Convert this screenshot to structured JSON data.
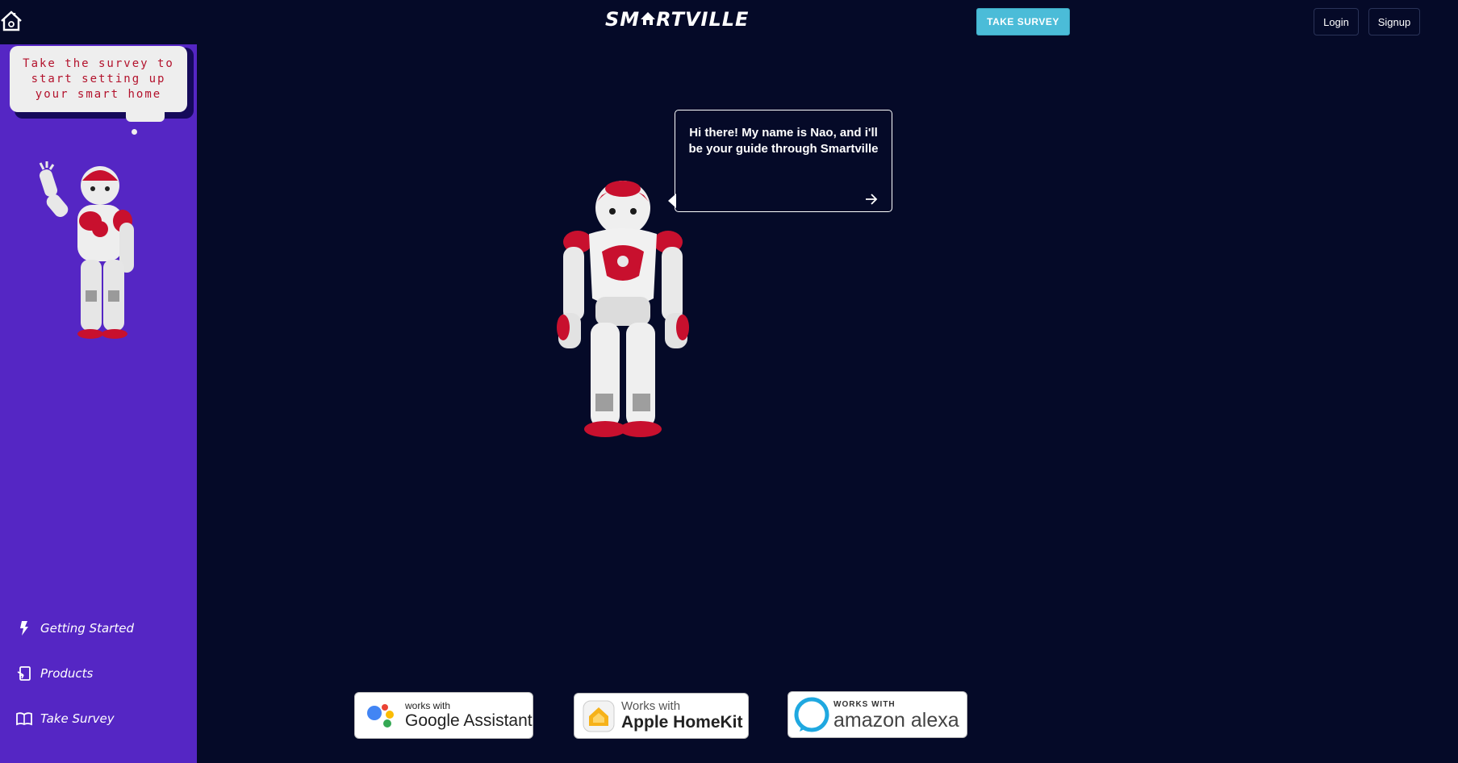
{
  "header": {
    "brand_prefix": "SM",
    "brand_suffix": "RTVILLE",
    "take_survey_label": "TAKE SURVEY",
    "login_label": "Login",
    "signup_label": "Signup"
  },
  "sidebar": {
    "thought_text": "Take the survey to start setting up your smart home",
    "items": [
      {
        "label": "Getting Started",
        "icon": "lightning-icon"
      },
      {
        "label": "Products",
        "icon": "device-icon"
      },
      {
        "label": "Take Survey",
        "icon": "book-icon"
      }
    ]
  },
  "main": {
    "speech_text": "Hi there! My name is Nao, and i'll be your guide through Smartville"
  },
  "badges": {
    "google": {
      "small": "works with",
      "big": "Google Assistant"
    },
    "homekit": {
      "small": "Works with",
      "big": "Apple HomeKit"
    },
    "alexa": {
      "small": "WORKS WITH",
      "big": "amazon alexa"
    }
  },
  "colors": {
    "background": "#050a28",
    "sidebar": "#5526c4",
    "survey_button": "#4bbcd8",
    "robot_accent": "#d0102a"
  }
}
